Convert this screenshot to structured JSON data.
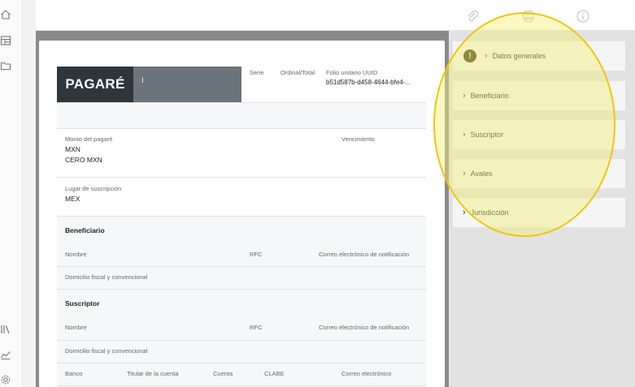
{
  "document": {
    "title": "PAGARÉ",
    "title_ext": "I",
    "header": {
      "serie_label": "Serie",
      "ordinal_label": "Ordinal/Total",
      "folio_label": "Folio unitario UUID",
      "folio_value": "b51d587b-d458-4644-bfe4-..."
    },
    "monto": {
      "label": "Monto del pagaré",
      "currency": "MXN",
      "amount_text": "CERO MXN",
      "vencimiento_label": "Vencimiento"
    },
    "lugar": {
      "label": "Lugar de suscripción",
      "value": "MEX"
    },
    "beneficiario": {
      "title": "Beneficiario",
      "nombre_label": "Nombre",
      "rfc_label": "RFC",
      "correo_label": "Correo electrónico de notificación",
      "domicilio_label": "Domicilio fiscal y convencional"
    },
    "suscriptor": {
      "title": "Suscriptor",
      "nombre_label": "Nombre",
      "rfc_label": "RFC",
      "correo_label": "Correo electrónico de notificación",
      "domicilio_label": "Domicilio fiscal y convencional",
      "banco_label": "Banco",
      "titular_label": "Titular de la cuenta",
      "cuenta_label": "Cuenta",
      "clabe_label": "CLABE",
      "correo2_label": "Correo electrónico"
    }
  },
  "panel": {
    "sections": [
      {
        "label": "Datos generales",
        "warning": "!"
      },
      {
        "label": "Beneficiario"
      },
      {
        "label": "Suscriptor"
      },
      {
        "label": "Avales"
      },
      {
        "label": "Jurisdicción"
      }
    ]
  },
  "icons": {
    "rail": [
      "home-icon",
      "layout-icon",
      "folder-icon",
      "library-icon",
      "chart-icon",
      "gear-icon"
    ],
    "top": [
      "paperclip-icon",
      "printer-icon",
      "info-icon"
    ]
  },
  "colors": {
    "doc_title_bg": "#2f363b",
    "doc_title_ext_bg": "#6b747c",
    "highlight_fill": "#f5f078",
    "highlight_stroke": "#f1c40f",
    "warning_bg": "#3a3310"
  }
}
